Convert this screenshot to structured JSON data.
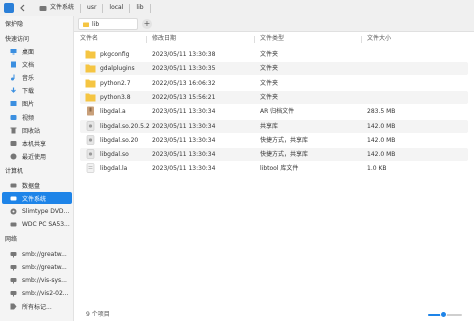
{
  "toolbar": {
    "breadcrumbs": [
      "文件系统",
      "usr",
      "local",
      "lib"
    ]
  },
  "tab": {
    "title": "lib",
    "add_label": "+"
  },
  "columns": {
    "name": "文件名",
    "modified": "修改日期",
    "type": "文件类型",
    "size": "文件大小"
  },
  "files": [
    {
      "name": "pkgconfig",
      "modified": "2023/05/11 13:30:38",
      "type": "文件夹",
      "size": "",
      "icon": "folder-icon"
    },
    {
      "name": "gdalplugins",
      "modified": "2023/05/11 13:30:35",
      "type": "文件夹",
      "size": "",
      "icon": "folder-icon"
    },
    {
      "name": "python2.7",
      "modified": "2022/05/13 16:06:32",
      "type": "文件夹",
      "size": "",
      "icon": "folder-icon"
    },
    {
      "name": "python3.8",
      "modified": "2022/05/13 15:56:21",
      "type": "文件夹",
      "size": "",
      "icon": "folder-icon"
    },
    {
      "name": "libgdal.a",
      "modified": "2023/05/11 13:30:34",
      "type": "AR 归档文件",
      "size": "283.5 MB",
      "icon": "archive-file-icon"
    },
    {
      "name": "libgdal.so.20.5.2",
      "modified": "2023/05/11 13:30:34",
      "type": "共享库",
      "size": "142.0 MB",
      "icon": "library-file-icon"
    },
    {
      "name": "libgdal.so.20",
      "modified": "2023/05/11 13:30:34",
      "type": "快捷方式，共享库",
      "size": "142.0 MB",
      "icon": "library-file-icon"
    },
    {
      "name": "libgdal.so",
      "modified": "2023/05/11 13:30:34",
      "type": "快捷方式，共享库",
      "size": "142.0 MB",
      "icon": "library-file-icon"
    },
    {
      "name": "libgdal.la",
      "modified": "2023/05/11 13:30:34",
      "type": "libtool 库文件",
      "size": "1.0 KB",
      "icon": "text-file-icon"
    }
  ],
  "sidebar": {
    "sections": [
      "保护隐",
      "快速访问",
      "计算机",
      "网络"
    ],
    "quick_access": [
      {
        "label": "桌面",
        "icon": "desktop-icon",
        "color": "#3b8fe0"
      },
      {
        "label": "文档",
        "icon": "document-icon",
        "color": "#3b8fe0"
      },
      {
        "label": "音乐",
        "icon": "music-icon",
        "color": "#3b8fe0"
      },
      {
        "label": "下载",
        "icon": "download-icon",
        "color": "#3b8fe0"
      },
      {
        "label": "图片",
        "icon": "picture-icon",
        "color": "#3b8fe0"
      },
      {
        "label": "视频",
        "icon": "video-icon",
        "color": "#3b8fe0"
      },
      {
        "label": "回收站",
        "icon": "trash-icon",
        "color": "#777777"
      },
      {
        "label": "本机共享",
        "icon": "share-icon",
        "color": "#777777"
      },
      {
        "label": "最近使用",
        "icon": "recent-icon",
        "color": "#777777"
      }
    ],
    "computer": [
      {
        "label": "数据盘",
        "icon": "drive-icon",
        "color": "#777777"
      },
      {
        "label": "文件系统",
        "icon": "filesystem-icon",
        "color": "#ffffff"
      },
      {
        "label": "Slimtype DVD...",
        "icon": "dvd-icon",
        "color": "#777777"
      },
      {
        "label": "WDC PC SA53...",
        "icon": "disk-icon",
        "color": "#777777"
      }
    ],
    "network": [
      {
        "label": "smb://greatw...",
        "icon": "network-share-icon",
        "color": "#777777"
      },
      {
        "label": "smb://greatw...",
        "icon": "network-share-icon",
        "color": "#777777"
      },
      {
        "label": "smb://vis-sys...",
        "icon": "network-share-icon",
        "color": "#777777"
      },
      {
        "label": "smb://vis2-02...",
        "icon": "network-share-icon",
        "color": "#777777"
      },
      {
        "label": "所有标记...",
        "icon": "tag-icon",
        "color": "#777777"
      }
    ]
  },
  "status": {
    "item_count": "9 个项目",
    "zoom_level": 0.45
  },
  "colors": {
    "accent": "#1e84e8",
    "folder": "#f5c542",
    "selection": "#1e84e8"
  }
}
